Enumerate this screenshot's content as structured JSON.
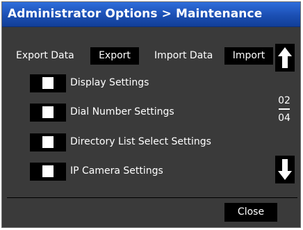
{
  "window": {
    "title": "Administrator Options > Maintenance"
  },
  "export": {
    "label": "Export Data",
    "button": "Export"
  },
  "import": {
    "label": "Import Data",
    "button": "Import"
  },
  "settings": [
    {
      "label": "Display Settings",
      "checked": false
    },
    {
      "label": "Dial Number Settings",
      "checked": false
    },
    {
      "label": "Directory List Select Settings",
      "checked": false
    },
    {
      "label": "IP Camera Settings",
      "checked": false
    }
  ],
  "pager": {
    "current": "02",
    "total": "04",
    "up_icon": "arrow-up-icon",
    "down_icon": "arrow-down-icon"
  },
  "footer": {
    "close_button": "Close"
  },
  "colors": {
    "title_bar": "#1b4fb3",
    "background": "#3a3a3a",
    "button": "#000000",
    "text": "#ffffff"
  }
}
